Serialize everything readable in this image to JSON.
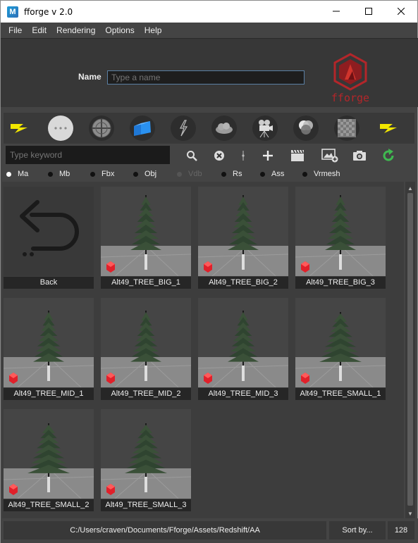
{
  "window": {
    "title": "fforge v 2.0",
    "app_icon_letter": "M"
  },
  "menu": [
    "File",
    "Edit",
    "Rendering",
    "Options",
    "Help"
  ],
  "name_field": {
    "label": "Name",
    "placeholder": "Type a name",
    "value": ""
  },
  "logo": {
    "text": "fforge",
    "color": "#c0282a"
  },
  "icon_bar": [
    "lightning-icon",
    "dots-icon",
    "sphere-grid-icon",
    "blue-cubes-icon",
    "lightning-circle-icon",
    "cloud-icon",
    "camera-rig-icon",
    "color-wheel-icon",
    "checker-icon",
    "lightning-icon"
  ],
  "search": {
    "placeholder": "Type keyword",
    "value": ""
  },
  "tools": [
    "search-icon",
    "clear-icon",
    "divider-icon",
    "add-icon",
    "clapperboard-icon",
    "image-add-icon",
    "camera-icon",
    "refresh-icon"
  ],
  "formats": [
    {
      "label": "Ma",
      "selected": true,
      "enabled": true
    },
    {
      "label": "Mb",
      "selected": false,
      "enabled": true
    },
    {
      "label": "Fbx",
      "selected": false,
      "enabled": true
    },
    {
      "label": "Obj",
      "selected": false,
      "enabled": true
    },
    {
      "label": "Vdb",
      "selected": false,
      "enabled": false
    },
    {
      "label": "Rs",
      "selected": false,
      "enabled": true
    },
    {
      "label": "Ass",
      "selected": false,
      "enabled": true
    },
    {
      "label": "Vrmesh",
      "selected": false,
      "enabled": true
    }
  ],
  "assets": [
    {
      "label": "Back"
    },
    {
      "label": "Alt49_TREE_BIG_1"
    },
    {
      "label": "Alt49_TREE_BIG_2"
    },
    {
      "label": "Alt49_TREE_BIG_3"
    },
    {
      "label": "Alt49_TREE_MID_1"
    },
    {
      "label": "Alt49_TREE_MID_2"
    },
    {
      "label": "Alt49_TREE_MID_3"
    },
    {
      "label": "Alt49_TREE_SMALL_1"
    },
    {
      "label": "Alt49_TREE_SMALL_2"
    },
    {
      "label": "Alt49_TREE_SMALL_3"
    }
  ],
  "status": {
    "path": "C:/Users/craven/Documents/Fforge/Assets/Redshift/AA",
    "sort_label": "Sort by...",
    "thumb_size": "128"
  },
  "colors": {
    "accent_yellow": "#f2e600",
    "redshift_red": "#e0202a",
    "refresh_green": "#3fb950"
  }
}
